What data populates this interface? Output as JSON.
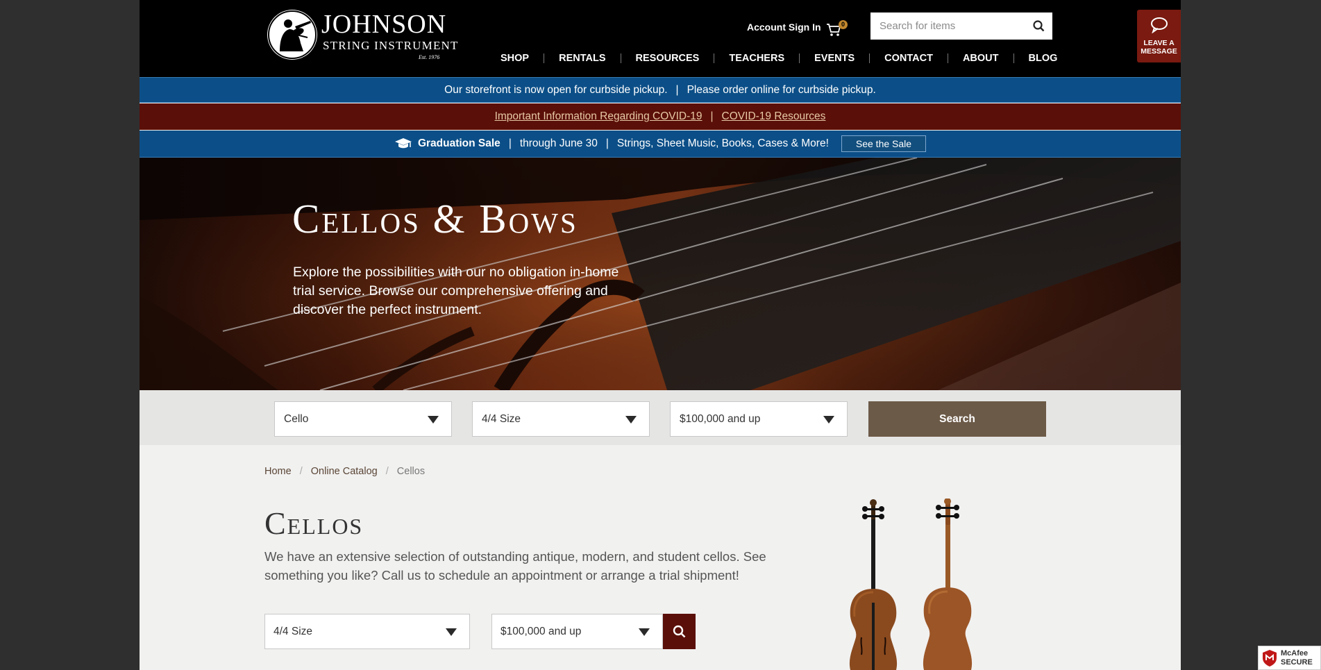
{
  "header": {
    "logo": {
      "name": "JOHNSON",
      "subtitle": "STRING INSTRUMENT",
      "established": "Est. 1976"
    },
    "account_signin": "Account Sign In",
    "cart_count": "0",
    "search": {
      "placeholder": "Search for items",
      "value": ""
    },
    "nav": [
      "SHOP",
      "RENTALS",
      "RESOURCES",
      "TEACHERS",
      "EVENTS",
      "CONTACT",
      "ABOUT",
      "BLOG"
    ],
    "leave_message": {
      "line1": "LEAVE A",
      "line2": "MESSAGE"
    }
  },
  "banners": {
    "curbside": {
      "part1": "Our storefront is now open for curbside pickup.",
      "separator": "|",
      "part2": "Please order online for curbside pickup."
    },
    "covid": {
      "link1": "Important Information Regarding COVID-19",
      "separator": "|",
      "link2": "COVID-19 Resources"
    },
    "sale": {
      "title": "Graduation Sale",
      "separator": "|",
      "dates": "through June 30",
      "items": "Strings, Sheet Music, Books, Cases & More!",
      "button": "See the Sale"
    }
  },
  "hero": {
    "title": "Cellos & Bows",
    "text": "Explore the possibilities with our no obligation in-home trial service. Browse our comprehensive offering and discover the perfect instrument."
  },
  "filter_bar": {
    "instrument": "Cello",
    "size": "4/4 Size",
    "price": "$100,000 and up",
    "search_label": "Search"
  },
  "breadcrumb": {
    "home": "Home",
    "catalog": "Online Catalog",
    "current": "Cellos",
    "separator": "/"
  },
  "content": {
    "title": "Cellos",
    "description": "We have an extensive selection of outstanding antique, modern, and student cellos. See something you like? Call us to schedule an appointment or arrange a trial shipment!",
    "size_filter": "4/4 Size",
    "price_filter": "$100,000 and up"
  },
  "mcafee": {
    "line1": "McAfee",
    "line2": "SECURE"
  },
  "colors": {
    "header_bg": "#000000",
    "banner_blue": "#0c4f88",
    "banner_red": "#5a0f08",
    "search_brown": "#6c5a48",
    "accent_maroon": "#7a1a10"
  },
  "icons": [
    "search-icon",
    "cart-icon",
    "chat-bubble-icon",
    "graduation-cap-icon",
    "chevron-down-icon",
    "violinist-logo-icon",
    "mcafee-shield-icon"
  ]
}
